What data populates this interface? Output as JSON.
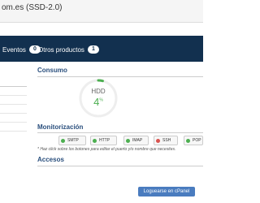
{
  "header": {
    "host_text": "om.es (SSD-2.0)"
  },
  "nav": {
    "items": [
      {
        "label": "Eventos",
        "count": "0"
      },
      {
        "label": "Otros productos",
        "count": "1"
      }
    ]
  },
  "consumo": {
    "title": "Consumo",
    "gauge": {
      "label": "HDD",
      "value": "4",
      "unit": "%",
      "percent": 4
    }
  },
  "monitor": {
    "title": "Monitorización",
    "buttons": [
      {
        "label": "SMTP",
        "status_color": "#4caf50"
      },
      {
        "label": "HTTP",
        "status_color": "#4caf50"
      },
      {
        "label": "IMAP",
        "status_color": "#4caf50"
      },
      {
        "label": "SSH",
        "status_color": "#d9534f"
      },
      {
        "label": "POP",
        "status_color": "#4caf50"
      }
    ],
    "note": "* Haz click sobre los botones para editar el puerto y/o nombre que necesites."
  },
  "accesos": {
    "title": "Accesos",
    "cpanel_label": "Loguearse en cPanel"
  },
  "colors": {
    "navbar": "#12304f",
    "section_title": "#2a4f7d",
    "ok": "#4caf50",
    "error": "#d9534f"
  }
}
